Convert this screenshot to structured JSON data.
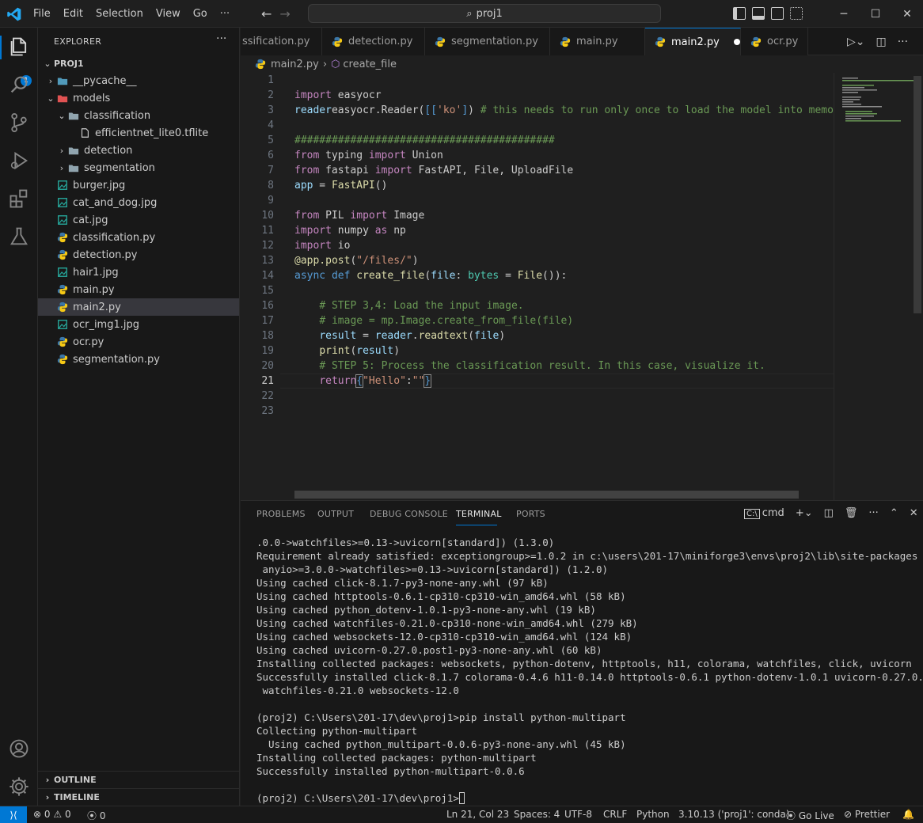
{
  "menu": [
    "File",
    "Edit",
    "Selection",
    "View",
    "Go",
    "···"
  ],
  "command_center": "proj1",
  "window_controls": [
    "─",
    "☐",
    "✕"
  ],
  "activity": {
    "badge": "1"
  },
  "explorer": {
    "title": "EXPLORER",
    "more": "···",
    "root": "PROJ1",
    "items": [
      {
        "label": "__pycache__",
        "depth": 1,
        "type": "folder",
        "chev": "›",
        "icon_color": "#519aba"
      },
      {
        "label": "models",
        "depth": 1,
        "type": "folder-open",
        "chev": "⌄",
        "icon_color": "#e05252"
      },
      {
        "label": "classification",
        "depth": 2,
        "type": "folder-open",
        "chev": "⌄",
        "icon_color": "#90a4ae"
      },
      {
        "label": "efficientnet_lite0.tflite",
        "depth": 3,
        "type": "file",
        "chev": "",
        "icon_color": "#cccccc"
      },
      {
        "label": "detection",
        "depth": 2,
        "type": "folder",
        "chev": "›",
        "icon_color": "#90a4ae"
      },
      {
        "label": "segmentation",
        "depth": 2,
        "type": "folder",
        "chev": "›",
        "icon_color": "#90a4ae"
      },
      {
        "label": "burger.jpg",
        "depth": 1,
        "type": "image",
        "chev": "",
        "icon_color": "#26a69a"
      },
      {
        "label": "cat_and_dog.jpg",
        "depth": 1,
        "type": "image",
        "chev": "",
        "icon_color": "#26a69a"
      },
      {
        "label": "cat.jpg",
        "depth": 1,
        "type": "image",
        "chev": "",
        "icon_color": "#26a69a"
      },
      {
        "label": "classification.py",
        "depth": 1,
        "type": "python",
        "chev": "",
        "icon_color": "#3572a5"
      },
      {
        "label": "detection.py",
        "depth": 1,
        "type": "python",
        "chev": "",
        "icon_color": "#3572a5"
      },
      {
        "label": "hair1.jpg",
        "depth": 1,
        "type": "image",
        "chev": "",
        "icon_color": "#26a69a"
      },
      {
        "label": "main.py",
        "depth": 1,
        "type": "python",
        "chev": "",
        "icon_color": "#3572a5"
      },
      {
        "label": "main2.py",
        "depth": 1,
        "type": "python",
        "chev": "",
        "icon_color": "#3572a5",
        "selected": true
      },
      {
        "label": "ocr_img1.jpg",
        "depth": 1,
        "type": "image",
        "chev": "",
        "icon_color": "#26a69a"
      },
      {
        "label": "ocr.py",
        "depth": 1,
        "type": "python",
        "chev": "",
        "icon_color": "#3572a5"
      },
      {
        "label": "segmentation.py",
        "depth": 1,
        "type": "python",
        "chev": "",
        "icon_color": "#3572a5"
      }
    ],
    "outline": "OUTLINE",
    "timeline": "TIMELINE"
  },
  "tabs": [
    {
      "label": "ssification.py",
      "active": false
    },
    {
      "label": "detection.py",
      "active": false
    },
    {
      "label": "segmentation.py",
      "active": false
    },
    {
      "label": "main.py",
      "active": false
    },
    {
      "label": "main2.py",
      "active": true,
      "dirty": true
    },
    {
      "label": "ocr.py",
      "active": false
    }
  ],
  "breadcrumb": {
    "file": "main2.py",
    "sep": "›",
    "symbol": "create_file"
  },
  "editor": {
    "current_line": 21,
    "lines": [
      [],
      [
        [
          "kw",
          "import"
        ],
        [
          "",
          "easyocr"
        ]
      ],
      [
        [
          "vr",
          "reader"
        ],
        [
          "",
          "easyocr.Reader("
        ],
        [
          "kb",
          "[["
        ],
        [
          "str",
          "'ko'"
        ],
        [
          "kb",
          "]"
        ],
        [
          "",
          ") "
        ],
        [
          "cm",
          "# this needs to run only once to load the model into memo"
        ]
      ],
      [],
      [
        [
          "cm",
          "##########################################"
        ]
      ],
      [
        [
          "kw",
          "from"
        ],
        [
          "",
          "typing "
        ],
        [
          "kw",
          "import"
        ],
        [
          "",
          "Union"
        ]
      ],
      [
        [
          "kw",
          "from"
        ],
        [
          "",
          "fastapi "
        ],
        [
          "kw",
          "import"
        ],
        [
          "",
          "FastAPI, File, UploadFile"
        ]
      ],
      [
        [
          "vr",
          "app"
        ],
        [
          "",
          " = "
        ],
        [
          "fn",
          "FastAPI"
        ],
        [
          "",
          "()"
        ]
      ],
      [],
      [
        [
          "kw",
          "from"
        ],
        [
          "",
          "PIL "
        ],
        [
          "kw",
          "import"
        ],
        [
          "",
          "Image"
        ]
      ],
      [
        [
          "kw",
          "import"
        ],
        [
          "",
          "numpy "
        ],
        [
          "kw",
          "as"
        ],
        [
          "",
          "np"
        ]
      ],
      [
        [
          "kw",
          "import"
        ],
        [
          "",
          "io"
        ]
      ],
      [
        [
          "fn",
          "@app.post"
        ],
        [
          "",
          "("
        ],
        [
          "str",
          "\"/files/\""
        ],
        [
          "",
          ")"
        ]
      ],
      [
        [
          "kb",
          "async"
        ],
        [
          "kb",
          "def"
        ],
        [
          "fn",
          "create_file"
        ],
        [
          "",
          "("
        ],
        [
          "vr",
          "file"
        ],
        [
          "",
          ": "
        ],
        [
          "ty",
          "bytes"
        ],
        [
          "",
          " = "
        ],
        [
          "fn",
          "File"
        ],
        [
          "",
          "()):"
        ]
      ],
      [],
      [
        [
          "",
          "    "
        ],
        [
          "cm",
          "# STEP 3,4: Load the input image."
        ]
      ],
      [
        [
          "",
          "    "
        ],
        [
          "cm",
          "# image = mp.Image.create_from_file(file)"
        ]
      ],
      [
        [
          "",
          "    "
        ],
        [
          "vr",
          "result"
        ],
        [
          "",
          " = "
        ],
        [
          "vr",
          "reader"
        ],
        [
          "",
          "."
        ],
        [
          "fn",
          "readtext"
        ],
        [
          "",
          "("
        ],
        [
          "vr",
          "file"
        ],
        [
          "",
          ")"
        ]
      ],
      [
        [
          "",
          "    "
        ],
        [
          "fn",
          "print"
        ],
        [
          "",
          "("
        ],
        [
          "vr",
          "result"
        ],
        [
          "",
          ")"
        ]
      ],
      [
        [
          "",
          "    "
        ],
        [
          "cm",
          "# STEP 5: Process the classification result. In this case, visualize it."
        ]
      ],
      [
        [
          "",
          "    "
        ],
        [
          "kw",
          "return"
        ],
        [
          "kb",
          "{"
        ],
        [
          "str",
          "\"Hello\""
        ],
        [
          "",
          ":"
        ],
        [
          "str",
          "\"\""
        ],
        [
          "kb",
          "}"
        ]
      ],
      [],
      []
    ]
  },
  "panel": {
    "tabs": [
      "PROBLEMS",
      "OUTPUT",
      "DEBUG CONSOLE",
      "TERMINAL",
      "PORTS"
    ],
    "active": "TERMINAL",
    "terminal_name": "cmd",
    "terminal": [
      ".0.0->watchfiles>=0.13->uvicorn[standard]) (1.3.0)",
      "Requirement already satisfied: exceptiongroup>=1.0.2 in c:\\users\\201-17\\miniforge3\\envs\\proj2\\lib\\site-packages (from",
      " anyio>=3.0.0->watchfiles>=0.13->uvicorn[standard]) (1.2.0)",
      "Using cached click-8.1.7-py3-none-any.whl (97 kB)",
      "Using cached httptools-0.6.1-cp310-cp310-win_amd64.whl (58 kB)",
      "Using cached python_dotenv-1.0.1-py3-none-any.whl (19 kB)",
      "Using cached watchfiles-0.21.0-cp310-none-win_amd64.whl (279 kB)",
      "Using cached websockets-12.0-cp310-cp310-win_amd64.whl (124 kB)",
      "Using cached uvicorn-0.27.0.post1-py3-none-any.whl (60 kB)",
      "Installing collected packages: websockets, python-dotenv, httptools, h11, colorama, watchfiles, click, uvicorn",
      "Successfully installed click-8.1.7 colorama-0.4.6 h11-0.14.0 httptools-0.6.1 python-dotenv-1.0.1 uvicorn-0.27.0.post1",
      " watchfiles-0.21.0 websockets-12.0",
      "",
      "(proj2) C:\\Users\\201-17\\dev\\proj1>pip install python-multipart",
      "Collecting python-multipart",
      "  Using cached python_multipart-0.0.6-py3-none-any.whl (45 kB)",
      "Installing collected packages: python-multipart",
      "Successfully installed python-multipart-0.0.6",
      ""
    ],
    "prompt": "(proj2) C:\\Users\\201-17\\dev\\proj1>"
  },
  "status": {
    "errors": "0",
    "warnings": "0",
    "ports": "0",
    "position": "Ln 21, Col 23",
    "spaces": "Spaces: 4",
    "encoding": "UTF-8",
    "eol": "CRLF",
    "language": "Python",
    "interpreter": "3.10.13 ('proj1': conda)",
    "golive": "Go Live",
    "prettier": "Prettier"
  }
}
